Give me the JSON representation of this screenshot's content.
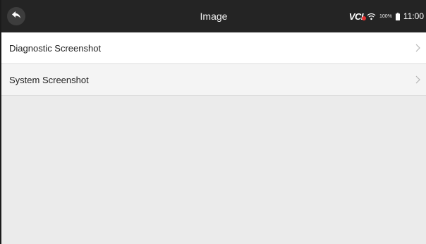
{
  "header": {
    "title": "Image",
    "status": {
      "vci_label": "VCI",
      "battery_percent": "100%",
      "time": "11:00"
    }
  },
  "list": {
    "items": [
      {
        "label": "Diagnostic Screenshot"
      },
      {
        "label": "System Screenshot"
      }
    ]
  }
}
